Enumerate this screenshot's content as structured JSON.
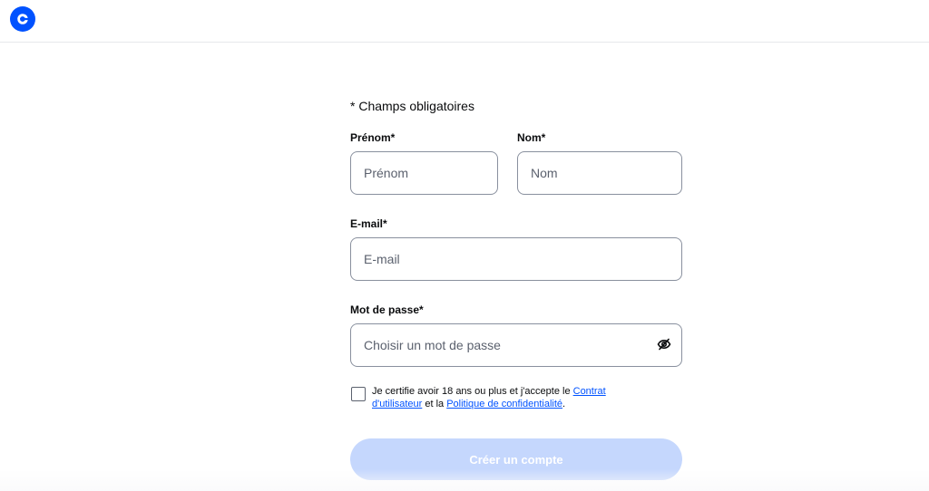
{
  "header": {
    "logo_icon": "coinbase-logo-icon",
    "brand_color": "#0052ff"
  },
  "form": {
    "required_note": "* Champs obligatoires",
    "first_name": {
      "label": "Prénom*",
      "placeholder": "Prénom",
      "value": ""
    },
    "last_name": {
      "label": "Nom*",
      "placeholder": "Nom",
      "value": ""
    },
    "email": {
      "label": "E-mail*",
      "placeholder": "E-mail",
      "value": ""
    },
    "password": {
      "label": "Mot de passe*",
      "placeholder": "Choisir un mot de passe",
      "value": "",
      "toggle_icon": "eye-slash-icon"
    },
    "terms": {
      "checked": false,
      "text_before": "Je certifie avoir 18 ans ou plus et j'accepte le ",
      "link_user_agreement": "Contrat d'utilisateur",
      "text_middle": " et la ",
      "link_privacy_policy": "Politique de confidentialité",
      "text_after": "."
    },
    "submit_label": "Créer un compte",
    "submit_color": "#c5d7fd"
  }
}
